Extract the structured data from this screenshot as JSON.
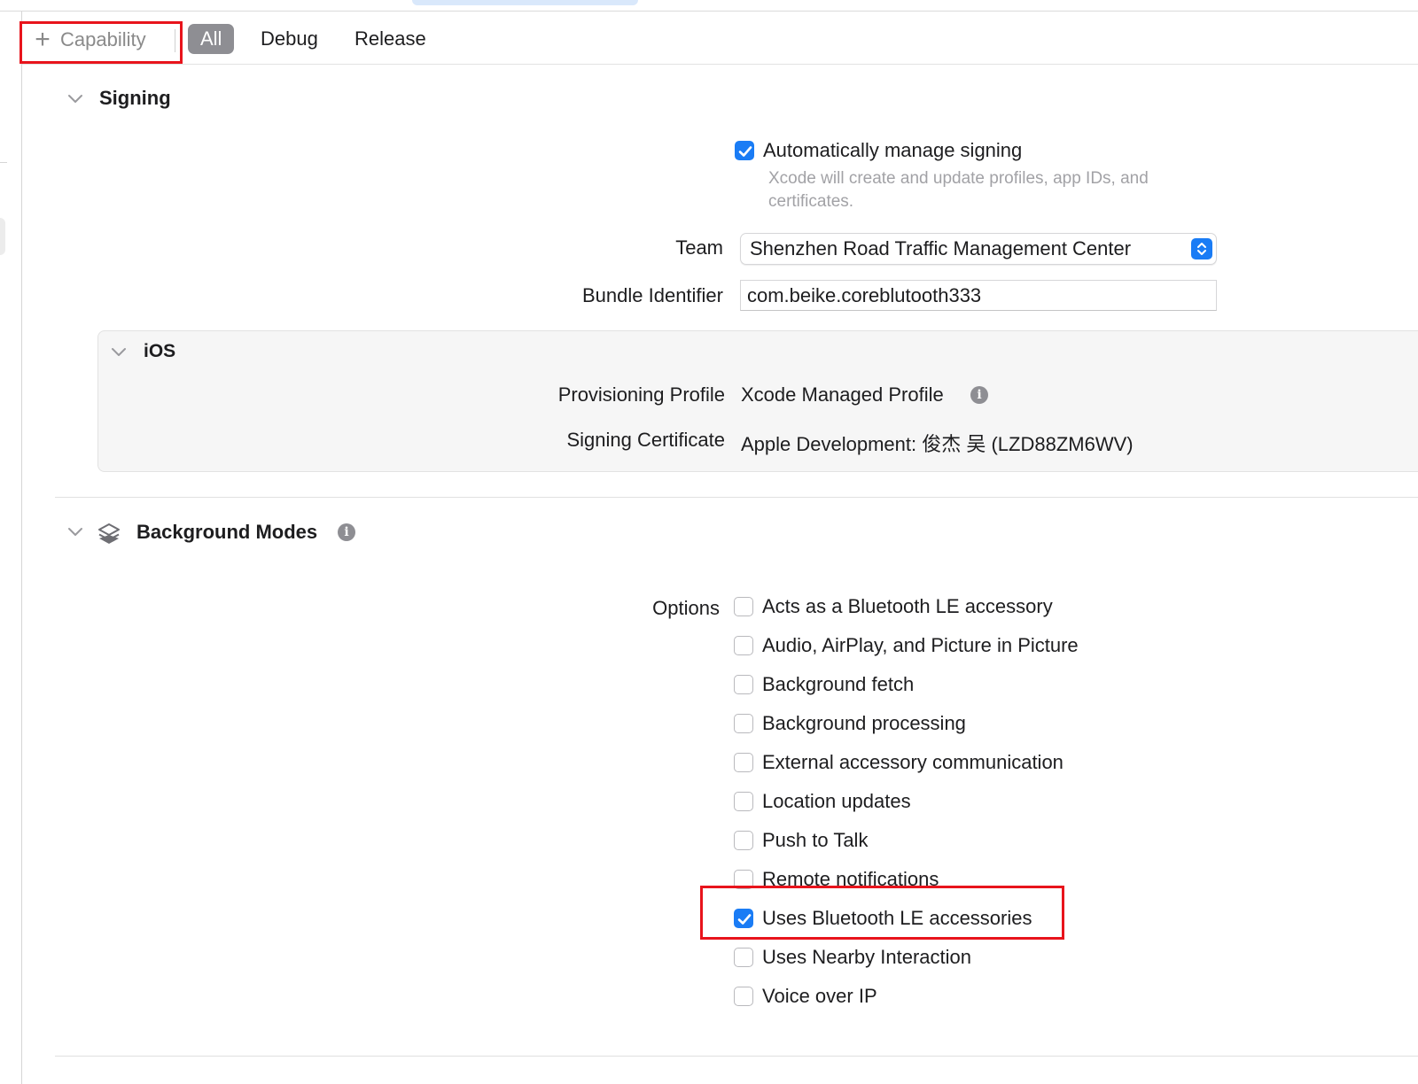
{
  "toolbar": {
    "capability_label": "Capability",
    "tabs": [
      {
        "label": "All",
        "active": true
      },
      {
        "label": "Debug",
        "active": false
      },
      {
        "label": "Release",
        "active": false
      }
    ]
  },
  "signing": {
    "title": "Signing",
    "auto_manage": {
      "label": "Automatically manage signing",
      "checked": true,
      "hint_line1": "Xcode will create and update profiles, app IDs, and",
      "hint_line2": "certificates."
    },
    "team": {
      "label": "Team",
      "value": "Shenzhen Road Traffic Management Center"
    },
    "bundle_identifier": {
      "label": "Bundle Identifier",
      "value": "com.beike.coreblutooth333"
    },
    "ios": {
      "title": "iOS",
      "provisioning_profile": {
        "label": "Provisioning Profile",
        "value": "Xcode Managed Profile"
      },
      "signing_certificate": {
        "label": "Signing Certificate",
        "value": "Apple Development: 俊杰 吴 (LZD88ZM6WV)"
      }
    }
  },
  "background_modes": {
    "title": "Background Modes",
    "options_label": "Options",
    "options": [
      {
        "label": "Acts as a Bluetooth LE accessory",
        "checked": false
      },
      {
        "label": "Audio, AirPlay, and Picture in Picture",
        "checked": false
      },
      {
        "label": "Background fetch",
        "checked": false
      },
      {
        "label": "Background processing",
        "checked": false
      },
      {
        "label": "External accessory communication",
        "checked": false
      },
      {
        "label": "Location updates",
        "checked": false
      },
      {
        "label": "Push to Talk",
        "checked": false
      },
      {
        "label": "Remote notifications",
        "checked": false
      },
      {
        "label": "Uses Bluetooth LE accessories",
        "checked": true
      },
      {
        "label": "Uses Nearby Interaction",
        "checked": false
      },
      {
        "label": "Voice over IP",
        "checked": false
      }
    ]
  },
  "colors": {
    "accent": "#1a7cf5",
    "highlight": "#e8141c",
    "tab_active_bg": "#8e8e93"
  }
}
